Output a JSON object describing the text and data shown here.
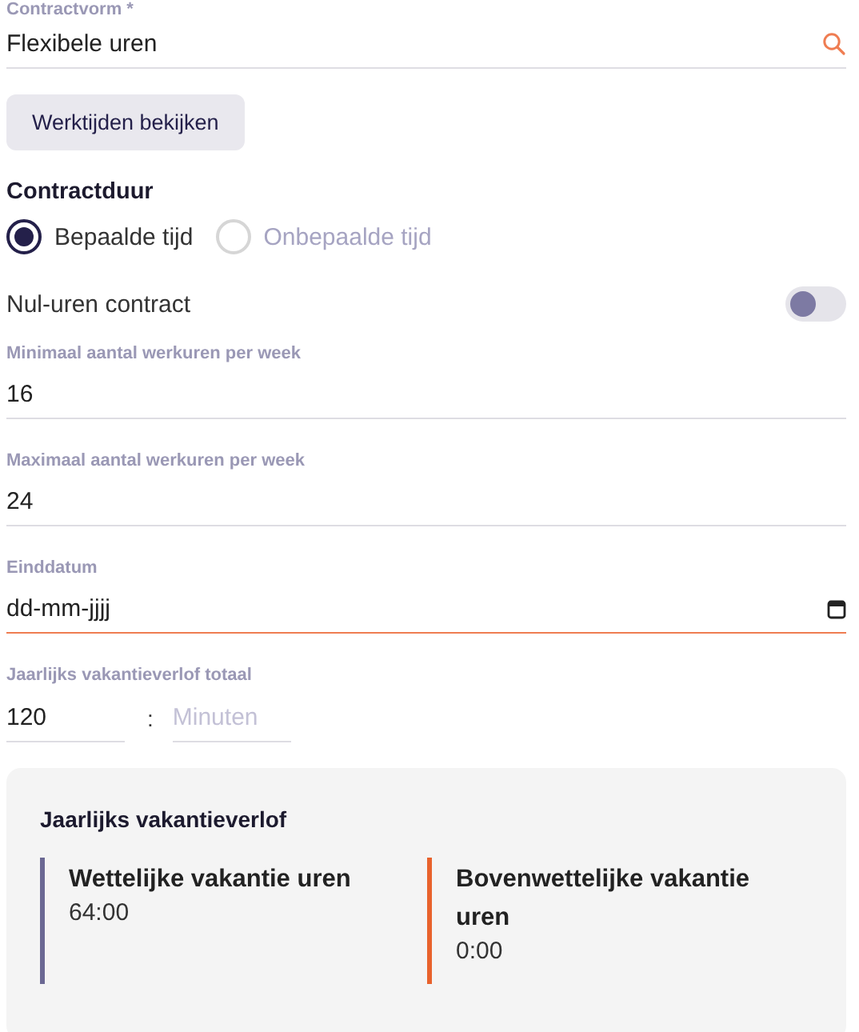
{
  "contract_form": {
    "label": "Contractvorm *",
    "value": "Flexibele uren"
  },
  "view_hours_button": "Werktijden bekijken",
  "contract_duration": {
    "title": "Contractduur",
    "options": [
      {
        "label": "Bepaalde tijd",
        "selected": true
      },
      {
        "label": "Onbepaalde tijd",
        "selected": false
      }
    ]
  },
  "zero_hours": {
    "label": "Nul-uren contract",
    "on": false
  },
  "min_hours": {
    "label": "Minimaal aantal werkuren per week",
    "value": "16"
  },
  "max_hours": {
    "label": "Maximaal aantal werkuren per week",
    "value": "24"
  },
  "end_date": {
    "label": "Einddatum",
    "value": "dd-mm-jjjj",
    "focused": true
  },
  "annual_leave_total": {
    "label": "Jaarlijks vakantieverlof totaal",
    "hours": "120",
    "separator": ":",
    "minutes_placeholder": "Minuten"
  },
  "leave_card": {
    "title": "Jaarlijks vakantieverlof",
    "items": [
      {
        "label": "Wettelijke vakantie uren",
        "value": "64:00",
        "color": "#6b6893"
      },
      {
        "label": "Bovenwettelijke vakantie uren",
        "value": "0:00",
        "color": "#e8622c"
      }
    ]
  }
}
